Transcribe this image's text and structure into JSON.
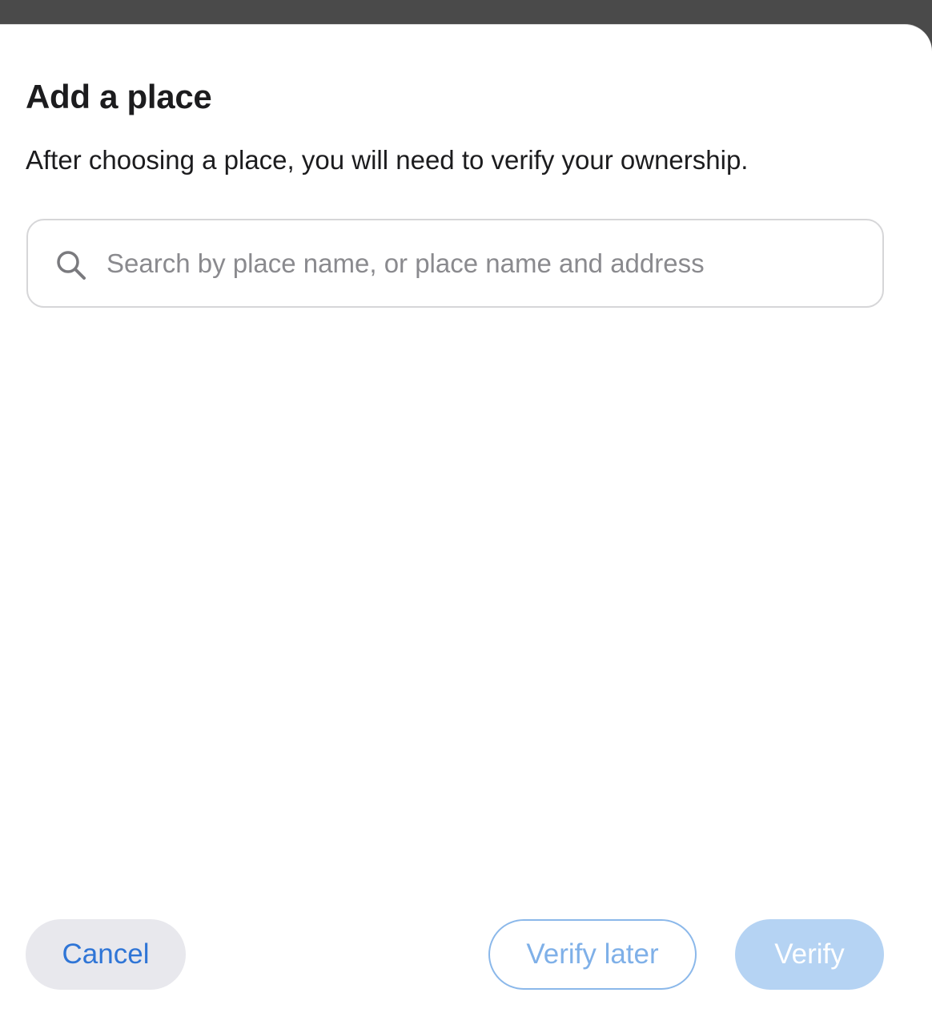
{
  "dialog": {
    "title": "Add a place",
    "subtitle": "After choosing a place, you will need to verify your ownership."
  },
  "search": {
    "icon": "search-icon",
    "value": "",
    "placeholder": "Search by place name, or place name and address"
  },
  "buttons": {
    "cancel_label": "Cancel",
    "verify_later_label": "Verify later",
    "verify_label": "Verify"
  },
  "colors": {
    "accent": "#2f75d6",
    "disabled_accent": "#b5d3f3",
    "backdrop": "#4a4a4a"
  }
}
